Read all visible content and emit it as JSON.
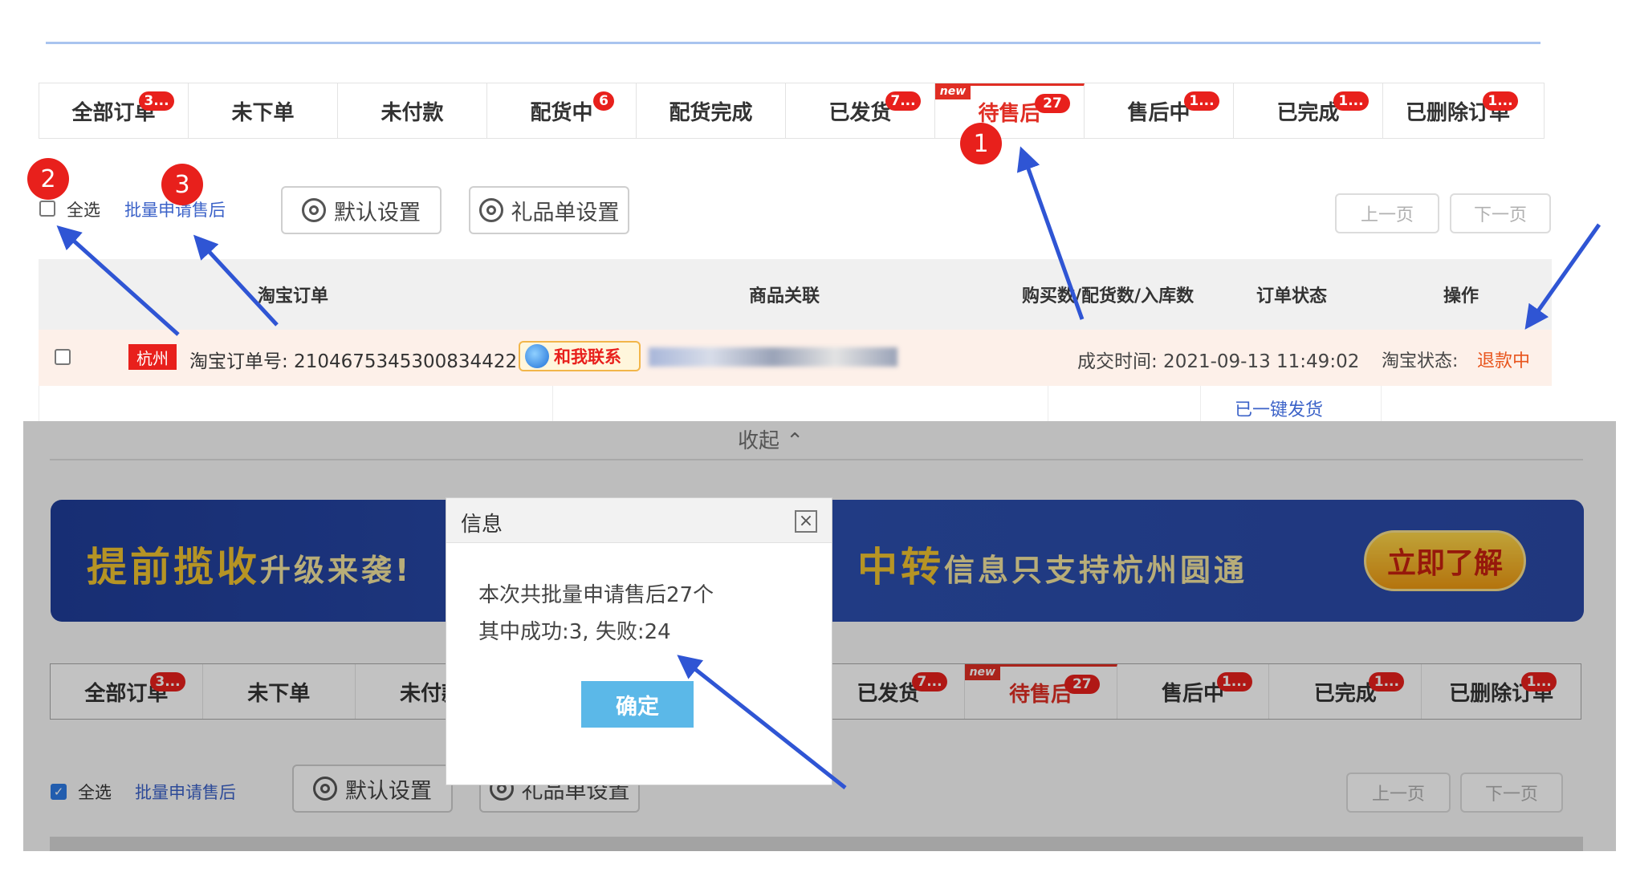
{
  "tabs": [
    {
      "label": "全部订单",
      "badge": "3..."
    },
    {
      "label": "未下单",
      "badge": ""
    },
    {
      "label": "未付款",
      "badge": ""
    },
    {
      "label": "配货中",
      "badge": "6"
    },
    {
      "label": "配货完成",
      "badge": ""
    },
    {
      "label": "已发货",
      "badge": "7..."
    },
    {
      "label": "待售后",
      "badge": "27",
      "new": "new",
      "active": true
    },
    {
      "label": "售后中",
      "badge": "1..."
    },
    {
      "label": "已完成",
      "badge": "1..."
    },
    {
      "label": "已删除订单",
      "badge": "1..."
    }
  ],
  "toolbar": {
    "select_all": "全选",
    "batch_apply": "批量申请售后",
    "default_settings": "默认设置",
    "gift_settings": "礼品单设置",
    "prev_page": "上一页",
    "next_page": "下一页"
  },
  "table": {
    "headers": [
      "淘宝订单",
      "商品关联",
      "购买数/配货数/入库数",
      "订单状态",
      "操作"
    ],
    "order": {
      "city": "杭州",
      "order_no": "淘宝订单号: 2104675345300834422",
      "contact": "和我联系",
      "deal_time": "成交时间: 2021-09-13 11:49:02",
      "taobao_status_label": "淘宝状态:",
      "taobao_status": "退款中",
      "shipped_link": "已一键发货"
    }
  },
  "overlay": {
    "collapse": "收起 ⌃",
    "banner_part1": "提前揽收",
    "banner_part1b": "升级来袭!",
    "banner_part2": "中转",
    "banner_part2b": "信息只支持杭州圆通",
    "banner_button": "立即了解",
    "tabs": [
      "全部订单",
      "未下单",
      "未付款",
      "",
      "",
      "已发货",
      "待售后",
      "售后中",
      "已完成",
      "已删除订单"
    ],
    "select_all": "全选",
    "batch_apply": "批量申请售后",
    "default_settings": "默认设置",
    "gift_settings": "礼品单设置",
    "prev_page": "上一页",
    "next_page": "下一页"
  },
  "dialog": {
    "title": "信息",
    "close": "×",
    "line1": "本次共批量申请售后27个",
    "line2": "其中成功:3, 失败:24",
    "ok": "确定"
  },
  "markers": [
    "1",
    "2",
    "3"
  ],
  "colors": {
    "accent_red": "#e02e24",
    "link_blue": "#3b62c8",
    "arrow_blue": "#2f55d4",
    "ok_button": "#5bb8e8"
  }
}
